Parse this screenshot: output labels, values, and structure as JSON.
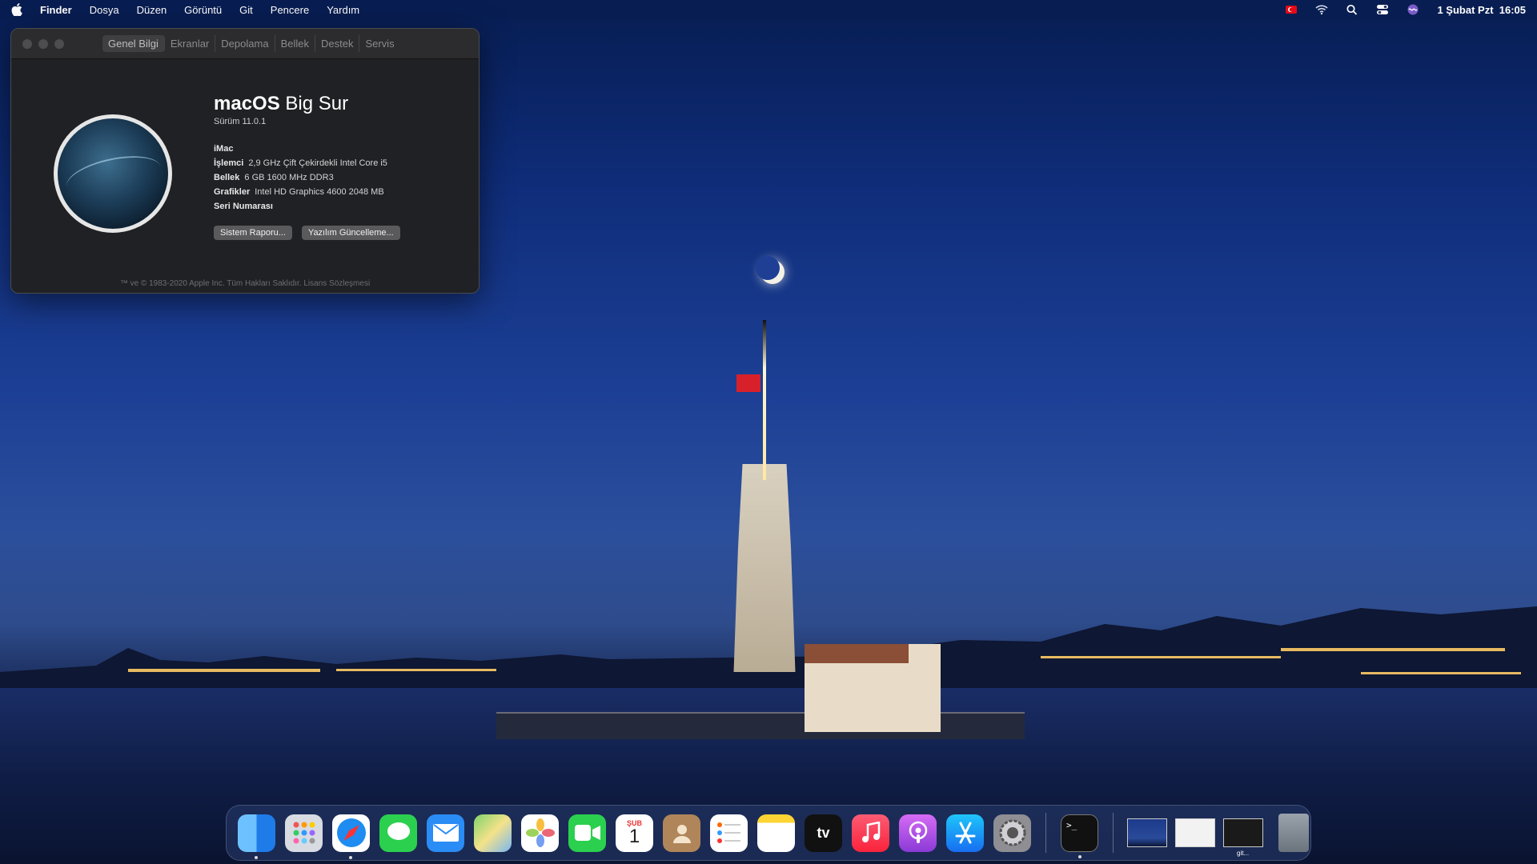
{
  "menubar": {
    "app": "Finder",
    "menus": [
      "Dosya",
      "Düzen",
      "Görüntü",
      "Git",
      "Pencere",
      "Yardım"
    ],
    "datetime": "1 Şubat Pzt  16:05"
  },
  "about": {
    "tabs": [
      "Genel Bilgi",
      "Ekranlar",
      "Depolama",
      "Bellek",
      "Destek",
      "Servis"
    ],
    "os_name_bold": "macOS",
    "os_name_rest": "Big Sur",
    "version": "Sürüm 11.0.1",
    "model": "iMac",
    "specs": [
      {
        "key": "İşlemci",
        "value": "2,9 GHz Çift Çekirdekli Intel Core i5"
      },
      {
        "key": "Bellek",
        "value": "6 GB 1600 MHz DDR3"
      },
      {
        "key": "Grafikler",
        "value": "Intel HD Graphics 4600 2048 MB"
      },
      {
        "key": "Seri Numarası",
        "value": ""
      }
    ],
    "buttons": {
      "report": "Sistem Raporu...",
      "update": "Yazılım Güncelleme..."
    },
    "footer": "™ ve © 1983-2020 Apple Inc. Tüm Hakları Saklıdır. Lisans Sözleşmesi"
  },
  "dock": {
    "calendar_month": "ŞUB",
    "calendar_day": "1",
    "tv_label": "tv",
    "thumb_label": "git..."
  },
  "colors": {
    "accent": "#0a84ff",
    "window_bg": "#202124"
  }
}
